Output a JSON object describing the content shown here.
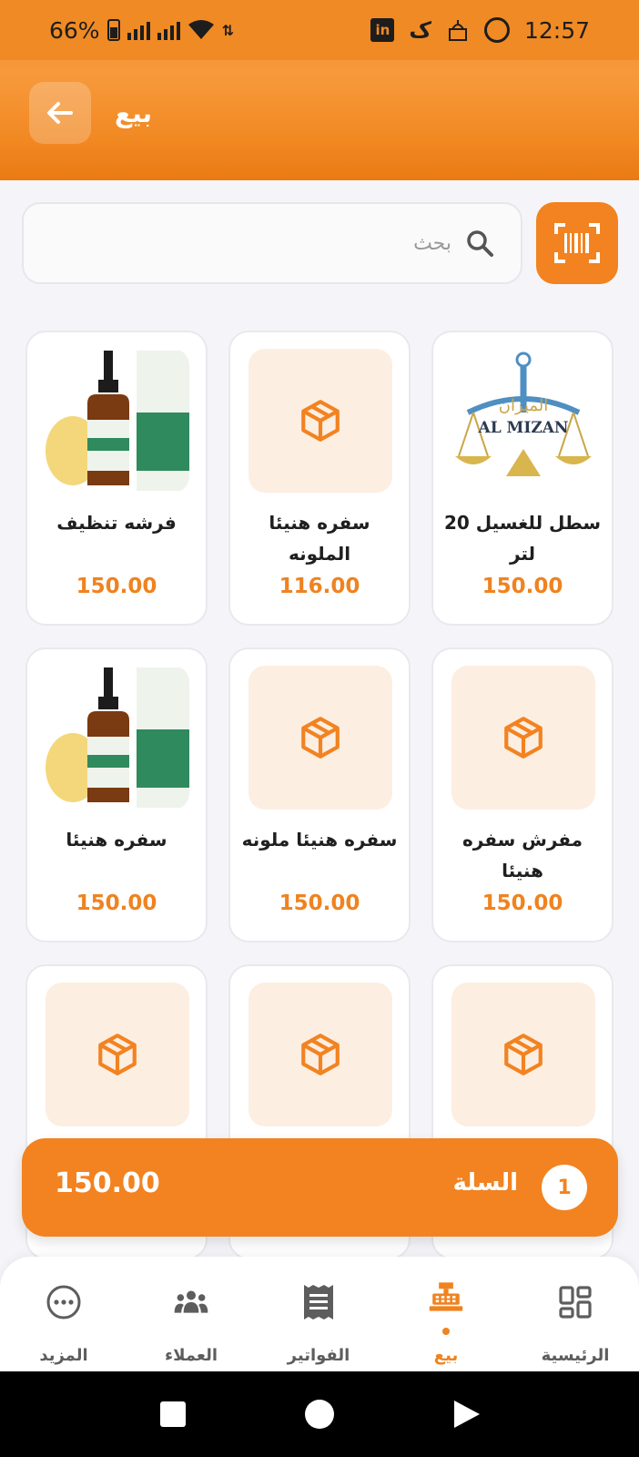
{
  "status_bar": {
    "battery": "66%",
    "time": "12:57",
    "linkedin_label": "in"
  },
  "header": {
    "title": "بيع"
  },
  "search": {
    "placeholder": "بحث",
    "value": ""
  },
  "products": [
    {
      "name": "فرشه تنظيف",
      "price": "150.00",
      "image": "serum-bottle"
    },
    {
      "name": "سفره هنيئا الملونه",
      "price": "116.00",
      "image": "box-icon"
    },
    {
      "name": "سطل للغسيل 20 لتر",
      "price": "150.00",
      "image": "al-mizan-logo"
    },
    {
      "name": "سفره هنيئا",
      "price": "150.00",
      "image": "serum-bottle"
    },
    {
      "name": "سفره هنيئا ملونه",
      "price": "150.00",
      "image": "box-icon"
    },
    {
      "name": "مفرش سفره هنيئا",
      "price": "150.00",
      "image": "box-icon"
    },
    {
      "name": "",
      "price": "",
      "image": "box-icon"
    },
    {
      "name": "",
      "price": "",
      "image": "box-icon"
    },
    {
      "name": "",
      "price": "",
      "image": "box-icon"
    }
  ],
  "logo_text": {
    "arabic": "الميزان",
    "latin": "AL MIZAN"
  },
  "cart": {
    "total": "150.00",
    "label": "السلة",
    "count": "1"
  },
  "nav": {
    "more": "المزيد",
    "customers": "العملاء",
    "invoices": "الفواتير",
    "sell": "بيع",
    "home": "الرئيسية"
  },
  "colors": {
    "accent": "#f28320",
    "tile": "#fdeee2"
  }
}
